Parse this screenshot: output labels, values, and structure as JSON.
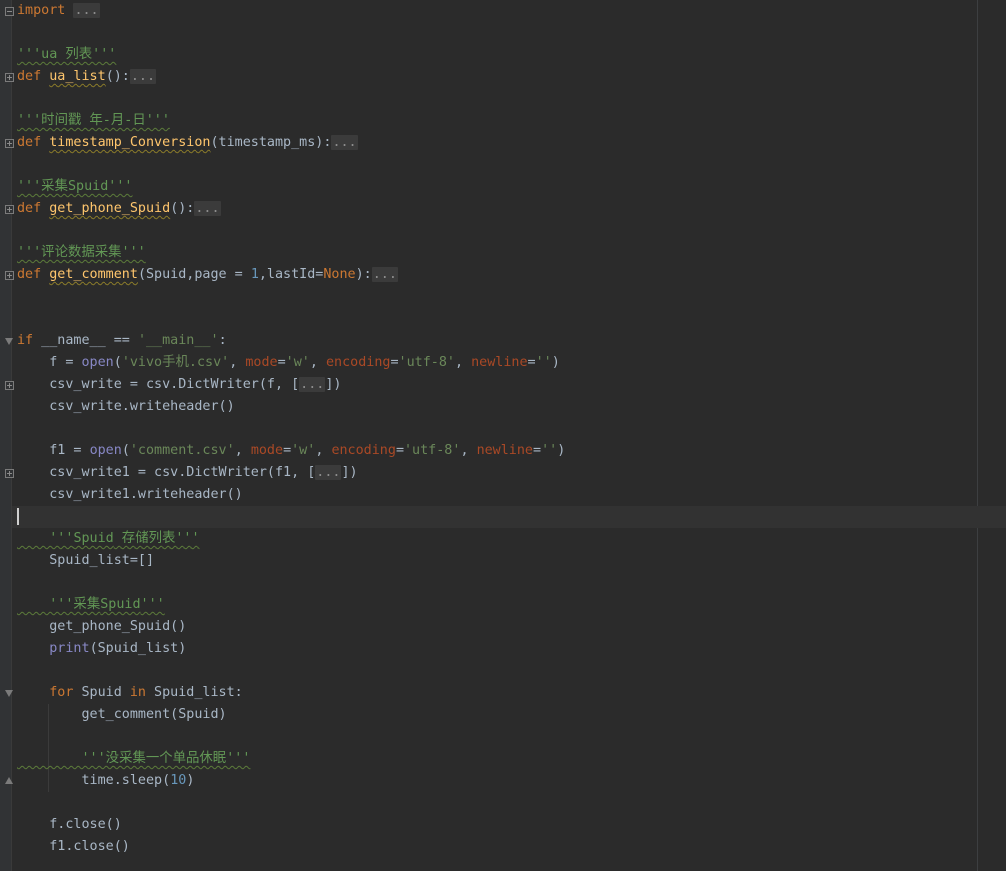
{
  "editor": {
    "lines": [
      [
        [
          "kw",
          "import"
        ],
        [
          "plain",
          " "
        ],
        [
          "fold",
          "..."
        ]
      ],
      [],
      [
        [
          "doc",
          "'''ua 列表'''"
        ]
      ],
      [
        [
          "kw",
          "def"
        ],
        [
          "plain",
          " "
        ],
        [
          "fn",
          "ua_list"
        ],
        [
          "plain",
          "():"
        ],
        [
          "fold",
          "..."
        ]
      ],
      [],
      [
        [
          "doc",
          "'''时间戳 年-月-日'''"
        ]
      ],
      [
        [
          "kw",
          "def"
        ],
        [
          "plain",
          " "
        ],
        [
          "fn",
          "timestamp_Conversion"
        ],
        [
          "plain",
          "(timestamp_ms):"
        ],
        [
          "fold",
          "..."
        ]
      ],
      [],
      [
        [
          "doc",
          "'''采集Spuid'''"
        ]
      ],
      [
        [
          "kw",
          "def"
        ],
        [
          "plain",
          " "
        ],
        [
          "fn",
          "get_phone_Spuid"
        ],
        [
          "plain",
          "():"
        ],
        [
          "fold",
          "..."
        ]
      ],
      [],
      [
        [
          "doc",
          "'''评论数据采集'''"
        ]
      ],
      [
        [
          "kw",
          "def"
        ],
        [
          "plain",
          " "
        ],
        [
          "fn",
          "get_comment"
        ],
        [
          "plain",
          "(Spuid,page = "
        ],
        [
          "num",
          "1"
        ],
        [
          "plain",
          ",lastId="
        ],
        [
          "kw",
          "None"
        ],
        [
          "plain",
          "):"
        ],
        [
          "fold",
          "..."
        ]
      ],
      [],
      [],
      [
        [
          "kw",
          "if"
        ],
        [
          "plain",
          " __name__ == "
        ],
        [
          "str",
          "'__main__'"
        ],
        [
          "plain",
          ":"
        ]
      ],
      [
        [
          "plain",
          "    f = "
        ],
        [
          "builtin",
          "open"
        ],
        [
          "plain",
          "("
        ],
        [
          "str",
          "'vivo手机.csv'"
        ],
        [
          "plain",
          ", "
        ],
        [
          "param",
          "mode"
        ],
        [
          "plain",
          "="
        ],
        [
          "str",
          "'w'"
        ],
        [
          "plain",
          ", "
        ],
        [
          "param",
          "encoding"
        ],
        [
          "plain",
          "="
        ],
        [
          "str",
          "'utf-8'"
        ],
        [
          "plain",
          ", "
        ],
        [
          "param",
          "newline"
        ],
        [
          "plain",
          "="
        ],
        [
          "str",
          "''"
        ],
        [
          "plain",
          ")"
        ]
      ],
      [
        [
          "plain",
          "    csv_write = csv.DictWriter(f, ["
        ],
        [
          "fold",
          "..."
        ],
        [
          "plain",
          "])"
        ]
      ],
      [
        [
          "plain",
          "    csv_write.writeheader()"
        ]
      ],
      [],
      [
        [
          "plain",
          "    f1 = "
        ],
        [
          "builtin",
          "open"
        ],
        [
          "plain",
          "("
        ],
        [
          "str",
          "'comment.csv'"
        ],
        [
          "plain",
          ", "
        ],
        [
          "param",
          "mode"
        ],
        [
          "plain",
          "="
        ],
        [
          "str",
          "'w'"
        ],
        [
          "plain",
          ", "
        ],
        [
          "param",
          "encoding"
        ],
        [
          "plain",
          "="
        ],
        [
          "str",
          "'utf-8'"
        ],
        [
          "plain",
          ", "
        ],
        [
          "param",
          "newline"
        ],
        [
          "plain",
          "="
        ],
        [
          "str",
          "''"
        ],
        [
          "plain",
          ")"
        ]
      ],
      [
        [
          "plain",
          "    csv_write1 = csv.DictWriter(f1, ["
        ],
        [
          "fold",
          "..."
        ],
        [
          "plain",
          "])"
        ]
      ],
      [
        [
          "plain",
          "    csv_write1.writeheader()"
        ]
      ],
      [],
      [
        [
          "doc",
          "    '''"
        ],
        [
          "doc",
          "Spuid"
        ],
        [
          "doc",
          " 存储列表'''"
        ]
      ],
      [
        [
          "plain",
          "    Spuid_list=[]"
        ]
      ],
      [],
      [
        [
          "doc",
          "    '''采集"
        ],
        [
          "doc",
          "Spuid"
        ],
        [
          "doc",
          "'''"
        ]
      ],
      [
        [
          "plain",
          "    get_phone_Spuid()"
        ]
      ],
      [
        [
          "plain",
          "    "
        ],
        [
          "builtin",
          "print"
        ],
        [
          "plain",
          "(Spuid_list)"
        ]
      ],
      [],
      [
        [
          "plain",
          "    "
        ],
        [
          "kw",
          "for"
        ],
        [
          "plain",
          " Spuid "
        ],
        [
          "kw",
          "in"
        ],
        [
          "plain",
          " Spuid_list:"
        ]
      ],
      [
        [
          "plain",
          "        get_comment(Spuid)"
        ]
      ],
      [],
      [
        [
          "doc",
          "        '''没采集一个单品休眠'''"
        ]
      ],
      [
        [
          "plain",
          "        time.sleep("
        ],
        [
          "num",
          "10"
        ],
        [
          "plain",
          ")"
        ]
      ],
      [],
      [
        [
          "plain",
          "    f.close()"
        ]
      ],
      [
        [
          "plain",
          "    f1.close()"
        ]
      ]
    ]
  }
}
